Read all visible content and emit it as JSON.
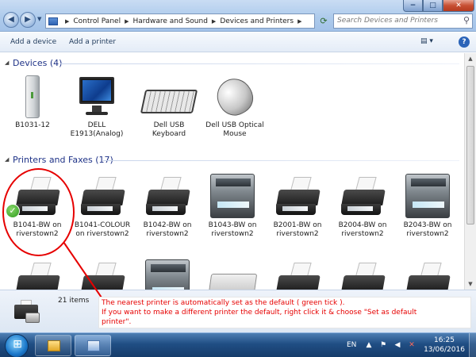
{
  "window": {
    "breadcrumb": [
      "Control Panel",
      "Hardware and Sound",
      "Devices and Printers"
    ],
    "search_placeholder": "Search Devices and Printers",
    "minimize": "−",
    "maximize": "□",
    "close": "✕"
  },
  "toolbar": {
    "add_device": "Add a device",
    "add_printer": "Add a printer",
    "help": "?"
  },
  "devices": {
    "header": "Devices (4)",
    "items": [
      {
        "label": "B1031-12",
        "icon": "external-drive-icon"
      },
      {
        "label": "DELL\nE1913(Analog)",
        "icon": "monitor-icon"
      },
      {
        "label": "Dell USB\nKeyboard",
        "icon": "keyboard-icon"
      },
      {
        "label": "Dell USB Optical\nMouse",
        "icon": "mouse-icon"
      }
    ]
  },
  "printers": {
    "header": "Printers and Faxes (17)",
    "items": [
      {
        "label": "B1041-BW on\nriverstown2",
        "icon": "printer-icon",
        "default": true
      },
      {
        "label": "B1041-COLOUR\non riverstown2",
        "icon": "printer-icon"
      },
      {
        "label": "B1042-BW on\nriverstown2",
        "icon": "printer-icon"
      },
      {
        "label": "B1043-BW on\nriverstown2",
        "icon": "multifunction-printer-icon"
      },
      {
        "label": "B2001-BW on\nriverstown2",
        "icon": "printer-icon"
      },
      {
        "label": "B2004-BW on\nriverstown2",
        "icon": "printer-icon"
      },
      {
        "label": "B2043-BW on\nriverstown2",
        "icon": "multifunction-printer-icon"
      }
    ],
    "partial_row_icons": [
      "printer-icon",
      "printer-icon",
      "multifunction-printer-icon",
      "fax-icon",
      "printer-icon",
      "printer-icon",
      "printer-icon"
    ]
  },
  "details": {
    "count": "21 items"
  },
  "annotation": {
    "line1": "The nearest printer is automatically set as the default ( green tick ).",
    "line2": "If you want to make a different printer the default, right click it & choose \"Set as default\nprinter\"."
  },
  "taskbar": {
    "language": "EN",
    "time": "16:25",
    "date": "13/06/2016"
  }
}
